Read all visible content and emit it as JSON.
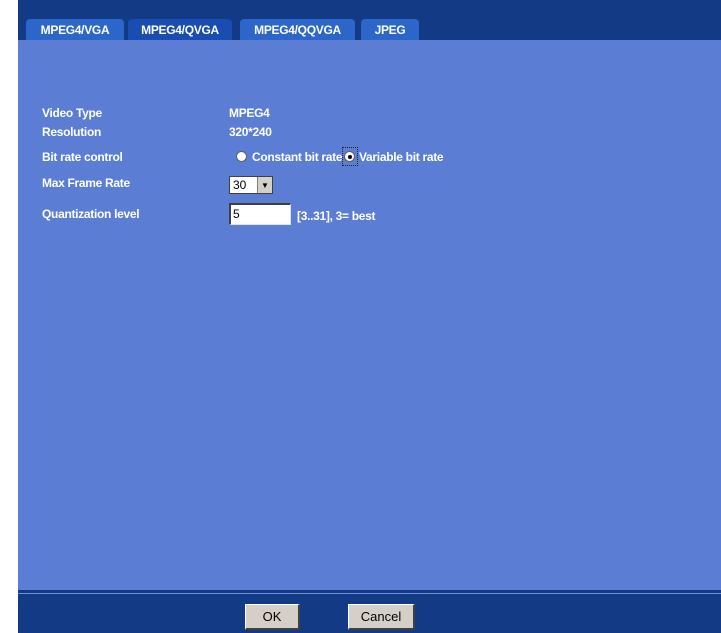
{
  "tabs": [
    {
      "label": "MPEG4/VGA",
      "active": false
    },
    {
      "label": "MPEG4/QVGA",
      "active": true
    },
    {
      "label": "MPEG4/QQVGA",
      "active": false
    },
    {
      "label": "JPEG",
      "active": false
    }
  ],
  "settings": {
    "video_type": {
      "label": "Video Type",
      "value": "MPEG4"
    },
    "resolution": {
      "label": "Resolution",
      "value": "320*240"
    },
    "bit_rate_control": {
      "label": "Bit rate control",
      "options": [
        "Constant bit rate",
        "Variable bit rate"
      ],
      "selected": "Variable bit rate"
    },
    "max_frame_rate": {
      "label": "Max Frame Rate",
      "value": "30"
    },
    "quantization_level": {
      "label": "Quantization level",
      "value": "5",
      "hint": "[3..31], 3= best"
    }
  },
  "buttons": {
    "ok": "OK",
    "cancel": "Cancel"
  },
  "colors": {
    "header_bg": "#133b85",
    "panel_bg": "#5b7dd4",
    "tab_bg": "#2c66c9",
    "text": "#ffffff",
    "button_bg": "#d4d0c8"
  },
  "icons": {
    "select_arrow": "chevron-down-icon"
  }
}
